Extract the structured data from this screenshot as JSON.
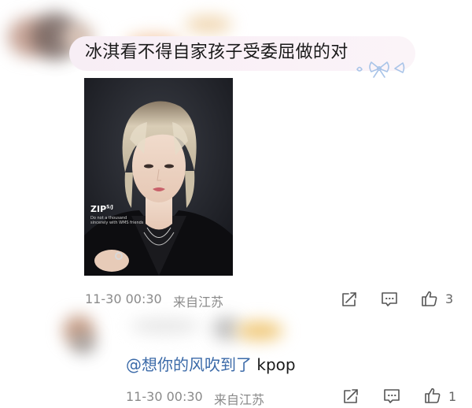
{
  "comment": {
    "text": "冰淇看不得自家孩子受委屈做的对",
    "timestamp": "11-30 00:30",
    "location": "来自江苏",
    "like_count": "3",
    "image": {
      "logo_text": "ZIP",
      "logo_sup": "S/J",
      "caption": "Do not a thousand sincerely with WMS friends"
    }
  },
  "reply": {
    "mention": "@想你的风吹到了",
    "text": " kpop",
    "timestamp": "11-30 00:30",
    "location": "来自江苏",
    "like_count": "1"
  },
  "icons": {
    "share": "share-icon",
    "comment": "comment-icon",
    "like": "thumbs-up-icon",
    "bow": "bow-icon"
  },
  "colors": {
    "bubble": "#f7eef5",
    "meta_text": "#8a8a8a",
    "mention": "#3b6aa8"
  }
}
